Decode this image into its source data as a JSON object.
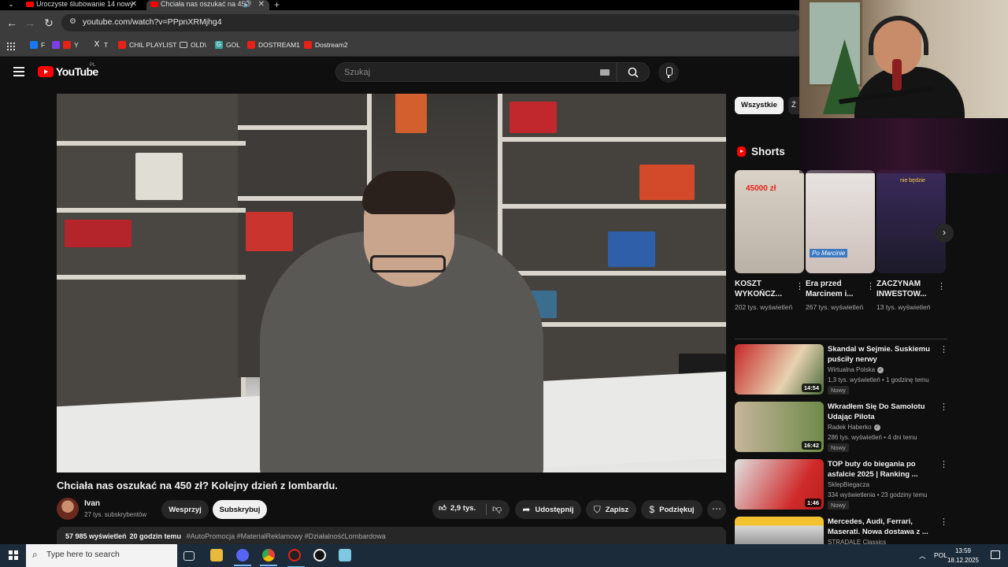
{
  "browser": {
    "tabs": [
      {
        "title": "Uroczyste ślubowanie 14 nowy"
      },
      {
        "title": "Chciała nas oszukać na 450"
      }
    ],
    "url": "youtube.com/watch?v=PPpnXRMjhg4",
    "bookmarks": [
      {
        "label": "F",
        "icon": "facebook-icon"
      },
      {
        "label": "Y",
        "icon": "youtube-icon"
      },
      {
        "label": "T",
        "icon": "x-icon"
      },
      {
        "label": "CHIL PLAYLIST",
        "icon": "youtube-icon"
      },
      {
        "label": "OLD\\",
        "icon": "folder-icon"
      },
      {
        "label": "GOL",
        "icon": "g-icon"
      },
      {
        "label": "DOSTREAM1",
        "icon": "youtube-icon"
      },
      {
        "label": "Dostream2",
        "icon": "youtube-icon"
      }
    ]
  },
  "youtube": {
    "logo_text": "YouTube",
    "country": "PL",
    "search_placeholder": "Szukaj",
    "video": {
      "title": "Chciała nas oszukać na 450 zł? Kolejny dzień z lombardu.",
      "channel": "Ivan",
      "subscribers": "27 tys. subskrybentów",
      "support_label": "Wesprzyj",
      "subscribe_label": "Subskrybuj",
      "likes": "2,9 tys.",
      "share_label": "Udostępnij",
      "save_label": "Zapisz",
      "thanks_label": "Podziękuj",
      "views": "57 985 wyświetleń",
      "age": "20 godzin temu",
      "hashtags": "#AutoPromocja #MateriałReklamowy #DziałalnośćLombardowa"
    },
    "chips": [
      "Wszystkie",
      "Ź"
    ],
    "shorts": {
      "heading": "Shorts",
      "items": [
        {
          "title": "KOSZT WYKOŃCZ...",
          "views": "202 tys. wyświetleń",
          "thumb_text": "45000 zł"
        },
        {
          "title": "Era przed Marcinem i...",
          "views": "267 tys. wyświetleń",
          "thumb_text": "Po Marcinie"
        },
        {
          "title": "ZACZYNAM INWESTOW...",
          "views": "13 tys. wyświetleń",
          "thumb_text": "nie będzie"
        }
      ]
    },
    "recommended": [
      {
        "title": "Skandal w Sejmie. Suskiemu puściły nerwy",
        "channel": "Wirtualna Polska",
        "meta": "1,3 tys. wyświetleń • 1 godzinę temu",
        "badge": "Nowy",
        "duration": "14:54"
      },
      {
        "title": "Wkradłem Się Do Samolotu Udając Pilota",
        "channel": "Radek Haberko",
        "meta": "286 tys. wyświetleń • 4 dni temu",
        "badge": "Nowy",
        "duration": "16:42"
      },
      {
        "title": "TOP buty do biegania po asfalcie 2025 | Ranking ...",
        "channel": "SklepBiegacza",
        "meta": "334 wyświetlenia • 23 godziny temu",
        "badge": "Nowy",
        "duration": "1:46"
      },
      {
        "title": "Mercedes, Audi, Ferrari, Maserati. Nowa dostawa z ...",
        "channel": "STRADALE Classics",
        "meta": "",
        "badge": "",
        "duration": ""
      }
    ]
  },
  "taskbar": {
    "search_placeholder": "Type here to search",
    "lang": "POL",
    "time": "13:59",
    "date": "18.12.2025"
  },
  "colors": {
    "accent_red": "#ff0000",
    "bg": "#0f0f0f",
    "taskbar": "#1c2b3a"
  }
}
